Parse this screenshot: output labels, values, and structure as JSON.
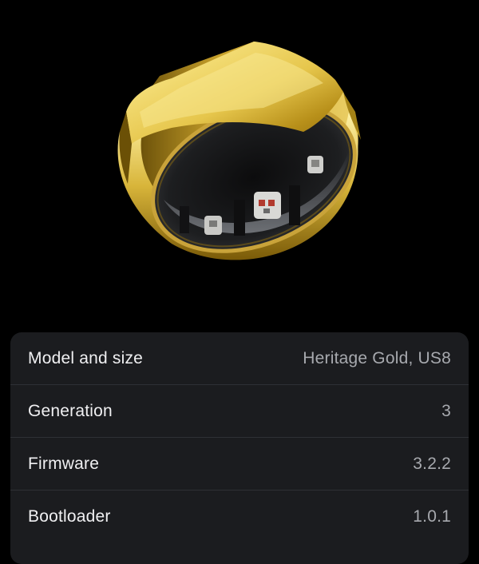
{
  "hero": {
    "image": "oura-ring-gold-render",
    "colors": {
      "background": "#000000",
      "gold": "#e8c94a",
      "interior": "#2a2b2d"
    }
  },
  "details": {
    "rows": [
      {
        "label": "Model and size",
        "value": "Heritage Gold, US8"
      },
      {
        "label": "Generation",
        "value": "3"
      },
      {
        "label": "Firmware",
        "value": "3.2.2"
      },
      {
        "label": "Bootloader",
        "value": "1.0.1"
      }
    ]
  }
}
